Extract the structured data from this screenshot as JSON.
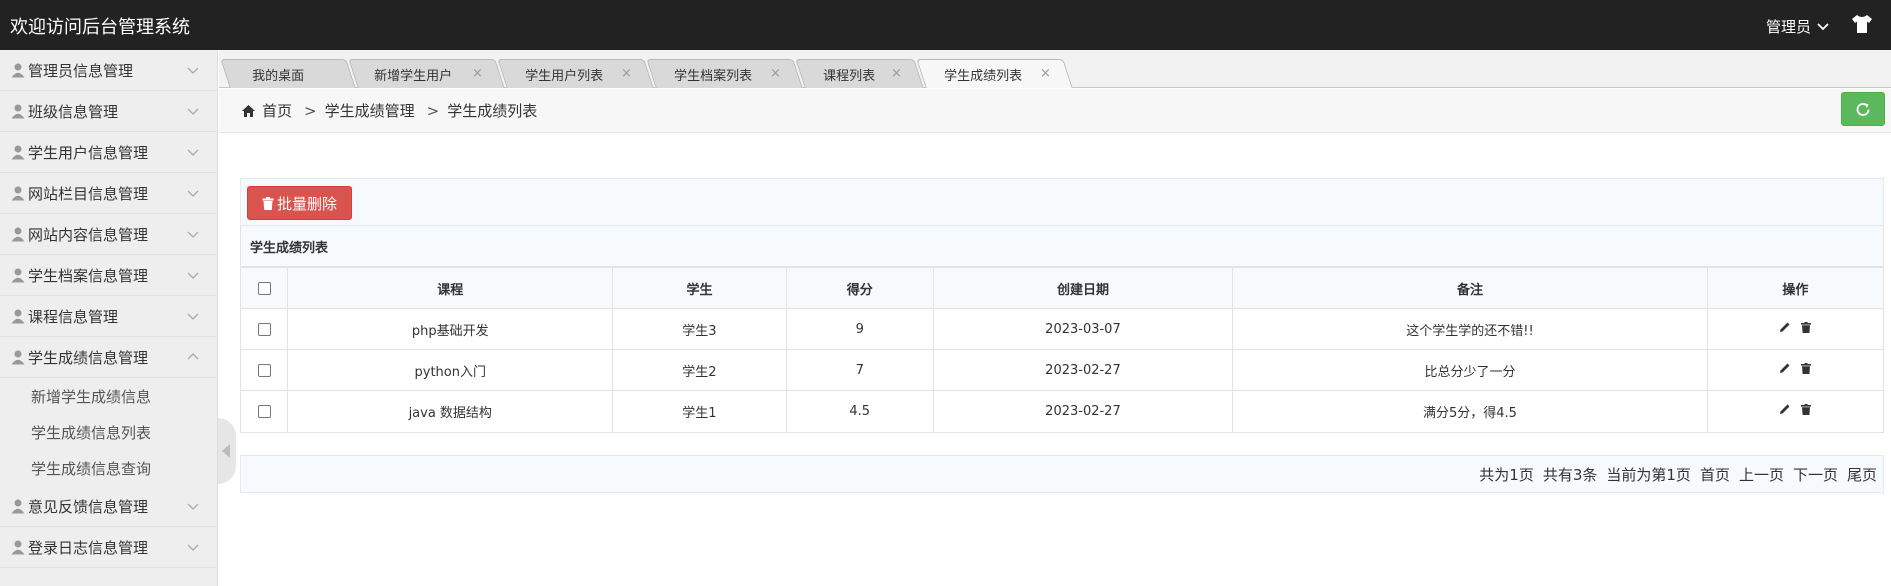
{
  "header": {
    "title": "欢迎访问后台管理系统",
    "user": "管理员"
  },
  "sidebar": {
    "items": [
      {
        "label": "管理员信息管理"
      },
      {
        "label": "班级信息管理"
      },
      {
        "label": "学生用户信息管理"
      },
      {
        "label": "网站栏目信息管理"
      },
      {
        "label": "网站内容信息管理"
      },
      {
        "label": "学生档案信息管理"
      },
      {
        "label": "课程信息管理"
      },
      {
        "label": "学生成绩信息管理"
      },
      {
        "label": "意见反馈信息管理"
      },
      {
        "label": "登录日志信息管理"
      }
    ],
    "sub_items": [
      {
        "label": "新增学生成绩信息"
      },
      {
        "label": "学生成绩信息列表"
      },
      {
        "label": "学生成绩信息查询"
      }
    ]
  },
  "tabs": [
    {
      "label": "我的桌面"
    },
    {
      "label": "新增学生用户"
    },
    {
      "label": "学生用户列表"
    },
    {
      "label": "学生档案列表"
    },
    {
      "label": "课程列表"
    },
    {
      "label": "学生成绩列表"
    }
  ],
  "breadcrumb": {
    "home": "首页",
    "level1": "学生成绩管理",
    "level2": "学生成绩列表",
    "sep": ">"
  },
  "toolbar": {
    "batch_delete": "批量删除"
  },
  "table": {
    "caption": "学生成绩列表",
    "columns": [
      "课程",
      "学生",
      "得分",
      "创建日期",
      "备注",
      "操作"
    ],
    "rows": [
      {
        "course": "php基础开发",
        "student": "学生3",
        "score": "9",
        "date": "2023-03-07",
        "note": "这个学生学的还不错!!"
      },
      {
        "course": "python入门",
        "student": "学生2",
        "score": "7",
        "date": "2023-02-27",
        "note": "比总分少了一分"
      },
      {
        "course": "java 数据结构",
        "student": "学生1",
        "score": "4.5",
        "date": "2023-02-27",
        "note": "满分5分，得4.5"
      }
    ]
  },
  "pager": {
    "total_pages": "共为1页",
    "total_items": "共有3条",
    "current": "当前为第1页",
    "first": "首页",
    "prev": "上一页",
    "next": "下一页",
    "last": "尾页"
  },
  "colors": {
    "header_bg": "#222222",
    "danger": "#d9534f",
    "success": "#5cb85c",
    "sidebar_bg": "#eeeeee"
  }
}
